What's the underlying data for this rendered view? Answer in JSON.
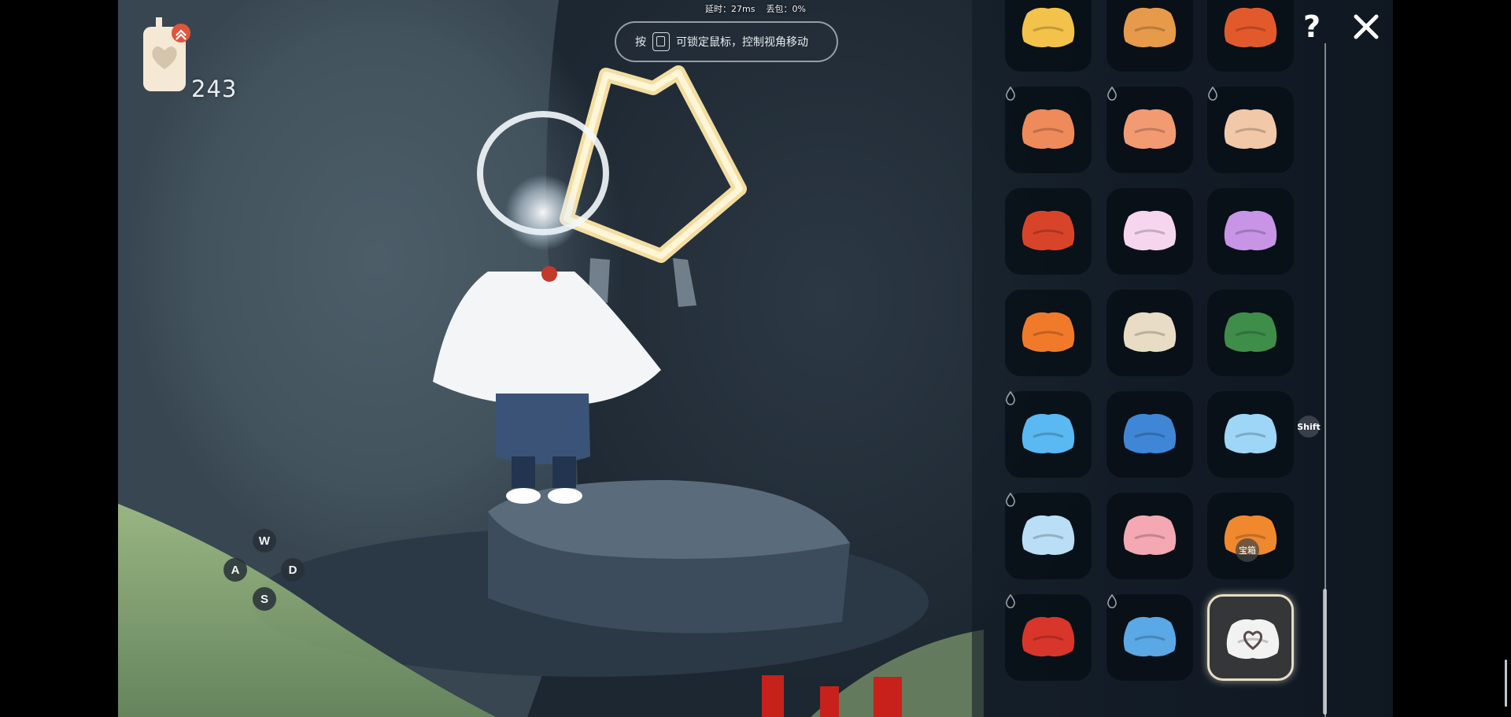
{
  "hud": {
    "candle_count": "243",
    "latency_label": "延时：27ms",
    "packet_loss_label": "丢包：0%",
    "hint": {
      "prefix": "按",
      "text": "可锁定鼠标，控制视角移动"
    }
  },
  "movement_keys": {
    "up": "W",
    "left": "A",
    "right": "D",
    "down": "S"
  },
  "panel": {
    "shift_hint": "Shift",
    "help_label": "?",
    "tiles": [
      {
        "icon": "cape-sun-tassels-icon",
        "color": "#f2c24a",
        "drop": false
      },
      {
        "icon": "cape-orange-fringe-icon",
        "color": "#e69a4a",
        "drop": false
      },
      {
        "icon": "cape-red-orange-icon",
        "color": "#e25a2c",
        "drop": false
      },
      {
        "icon": "cape-coral-bow-icon",
        "color": "#ef8a5a",
        "drop": true
      },
      {
        "icon": "cape-peach-horn-icon",
        "color": "#f29a72",
        "drop": true
      },
      {
        "icon": "cape-winged-horn-icon",
        "color": "#f1c8a8",
        "drop": true
      },
      {
        "icon": "cape-red-medallion-icon",
        "color": "#d8442a",
        "drop": false
      },
      {
        "icon": "cape-pink-petal-icon",
        "color": "#f6d6ee",
        "drop": false
      },
      {
        "icon": "cape-lilac-bulb-icon",
        "color": "#c794e6",
        "drop": false
      },
      {
        "icon": "cape-orange-bell-icon",
        "color": "#f07a2a",
        "drop": false
      },
      {
        "icon": "cape-cream-leaf-icon",
        "color": "#e8dcc4",
        "drop": false
      },
      {
        "icon": "cape-green-sprout-icon",
        "color": "#3e8e4a",
        "drop": false
      },
      {
        "icon": "cape-blue-wave-icon",
        "color": "#5ab8f2",
        "drop": true
      },
      {
        "icon": "cape-blue-dotted-icon",
        "color": "#3f86d6",
        "drop": false
      },
      {
        "icon": "cape-skyblue-arch-icon",
        "color": "#9dd6f6",
        "drop": false
      },
      {
        "icon": "cape-paleblue-arch-icon",
        "color": "#b9def6",
        "drop": true
      },
      {
        "icon": "cape-pink-knit-icon",
        "color": "#f4a8b2",
        "drop": false
      },
      {
        "icon": "cape-orange-maple-icon",
        "color": "#f0882e",
        "drop": false,
        "badge": "宝箱"
      },
      {
        "icon": "cape-crimson-icon",
        "color": "#d8362a",
        "drop": true
      },
      {
        "icon": "cape-blue-star-icon",
        "color": "#5aa8e6",
        "drop": true
      },
      {
        "icon": "cape-white-heart-icon",
        "color": "#f2f2f2",
        "drop": false,
        "selected": true
      }
    ]
  }
}
